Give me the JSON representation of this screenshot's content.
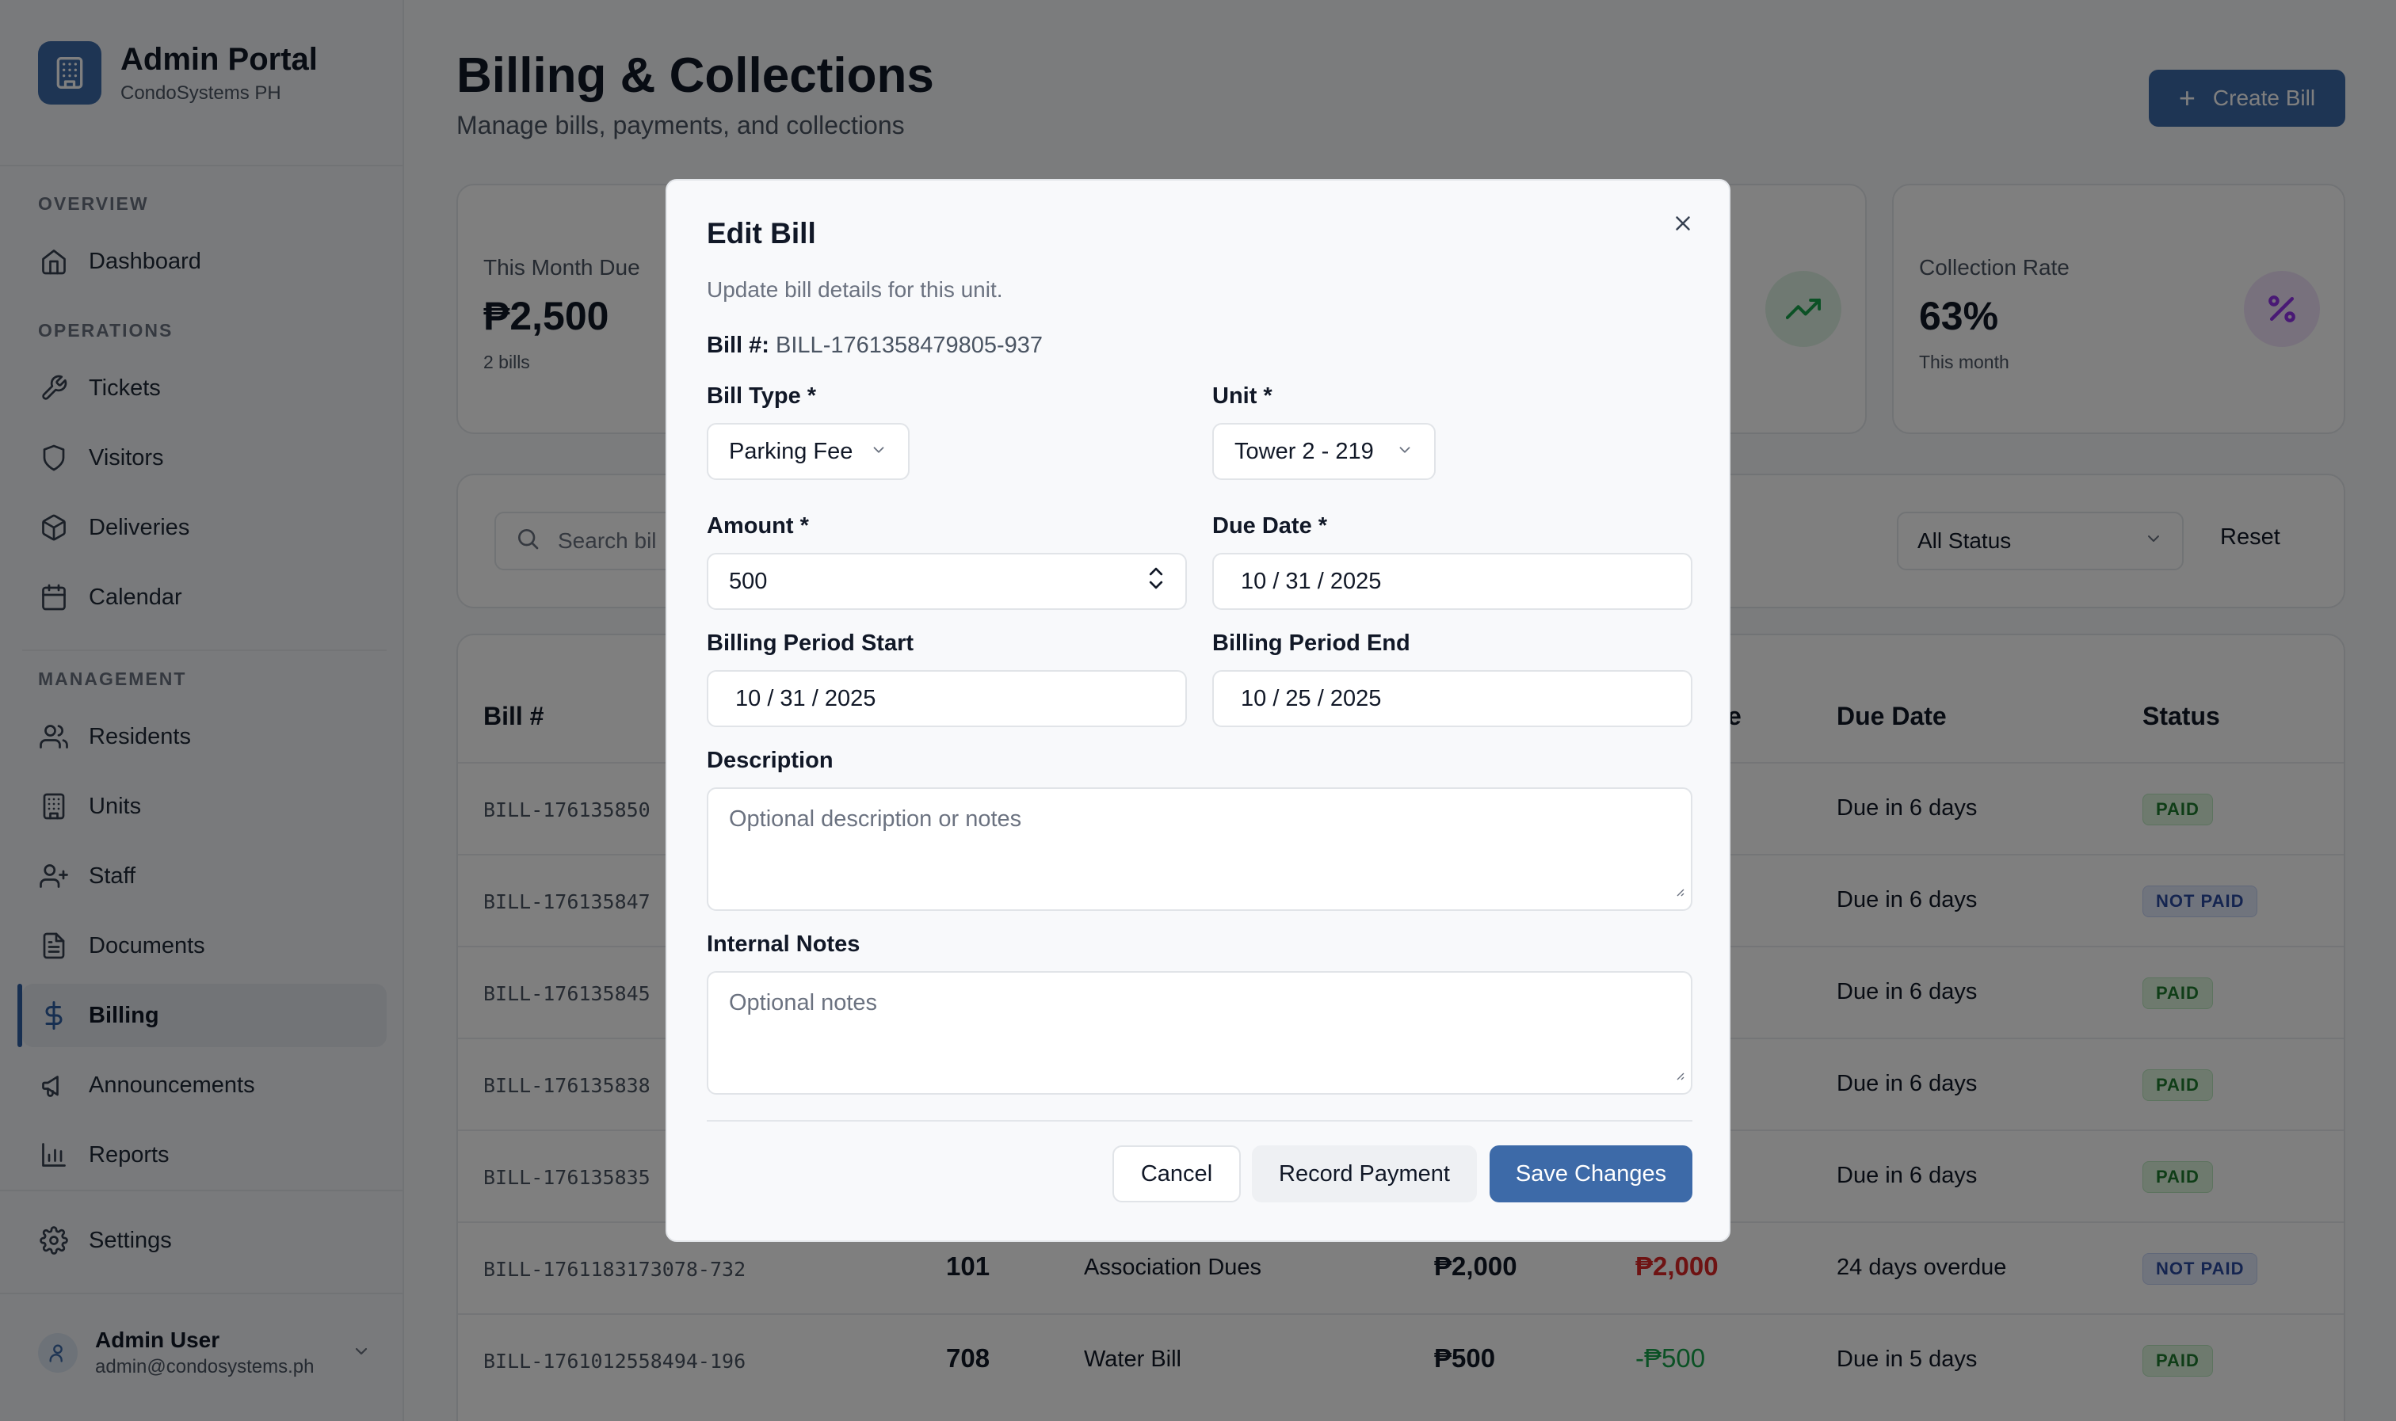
{
  "brand": {
    "title": "Admin Portal",
    "subtitle": "CondoSystems PH"
  },
  "nav": {
    "overview_label": "OVERVIEW",
    "operations_label": "OPERATIONS",
    "management_label": "MANAGEMENT",
    "items": [
      {
        "label": "Dashboard",
        "icon": "home-icon"
      },
      {
        "label": "Tickets",
        "icon": "wrench-icon"
      },
      {
        "label": "Visitors",
        "icon": "shield-icon"
      },
      {
        "label": "Deliveries",
        "icon": "package-icon"
      },
      {
        "label": "Calendar",
        "icon": "calendar-icon"
      },
      {
        "label": "Residents",
        "icon": "users-icon"
      },
      {
        "label": "Units",
        "icon": "building-icon"
      },
      {
        "label": "Staff",
        "icon": "user-plus-icon"
      },
      {
        "label": "Documents",
        "icon": "file-icon"
      },
      {
        "label": "Billing",
        "icon": "dollar-icon",
        "active": true
      },
      {
        "label": "Announcements",
        "icon": "megaphone-icon"
      },
      {
        "label": "Reports",
        "icon": "bar-chart-icon"
      },
      {
        "label": "Settings",
        "icon": "gear-icon"
      }
    ]
  },
  "user": {
    "name": "Admin User",
    "email": "admin@condosystems.ph"
  },
  "page": {
    "title": "Billing & Collections",
    "subtitle": "Manage bills, payments, and collections",
    "create_label": "Create Bill"
  },
  "stats": {
    "month_due": {
      "label": "This Month Due",
      "value": "₱2,500",
      "foot": "2 bills"
    },
    "collection": {
      "label": "Collection Rate",
      "value": "63%",
      "foot": "This month"
    }
  },
  "filters": {
    "search_placeholder": "Search bil",
    "status_value": "All Status",
    "reset_label": "Reset"
  },
  "table": {
    "headers": {
      "bill": "Bill #",
      "balance_partial": "e",
      "due": "Due Date",
      "status": "Status"
    },
    "rows": [
      {
        "bill": "BILL-176135850",
        "due": "Due in 6 days",
        "status": "PAID"
      },
      {
        "bill": "BILL-176135847",
        "due": "Due in 6 days",
        "status": "NOT PAID"
      },
      {
        "bill": "BILL-176135845",
        "due": "Due in 6 days",
        "status": "PAID"
      },
      {
        "bill": "BILL-176135838",
        "due": "Due in 6 days",
        "status": "PAID"
      },
      {
        "bill": "BILL-176135835",
        "due": "Due in 6 days",
        "status": "PAID"
      },
      {
        "bill": "BILL-1761183173078-732",
        "unit": "101",
        "type": "Association Dues",
        "amount": "₱2,000",
        "balance": "₱2,000",
        "due": "24 days overdue",
        "status": "NOT PAID"
      },
      {
        "bill": "BILL-1761012558494-196",
        "unit": "708",
        "type": "Water Bill",
        "amount": "₱500",
        "balance": "-₱500",
        "due": "Due in 5 days",
        "status": "PAID"
      }
    ]
  },
  "modal": {
    "title": "Edit Bill",
    "description": "Update bill details for this unit.",
    "bill_no_label": "Bill #:",
    "bill_no": "BILL-1761358479805-937",
    "bill_type_label": "Bill Type *",
    "bill_type_value": "Parking Fee",
    "unit_label": "Unit *",
    "unit_value": "Tower 2 - 219",
    "amount_label": "Amount *",
    "amount_value": "500",
    "due_date_label": "Due Date *",
    "due_date_value": "10 / 31 / 2025",
    "period_start_label": "Billing Period Start",
    "period_start_value": "10 / 31 / 2025",
    "period_end_label": "Billing Period End",
    "period_end_value": "10 / 25 / 2025",
    "description_label": "Description",
    "description_placeholder": "Optional description or notes",
    "notes_label": "Internal Notes",
    "notes_placeholder": "Optional notes",
    "cancel_label": "Cancel",
    "record_label": "Record Payment",
    "save_label": "Save Changes"
  },
  "colors": {
    "accent": "#3d6aa8",
    "paid_bg": "#dcf5dd",
    "notpaid_bg": "#e1e8fb",
    "overdue": "#dc2626",
    "credit": "#16a34a"
  }
}
